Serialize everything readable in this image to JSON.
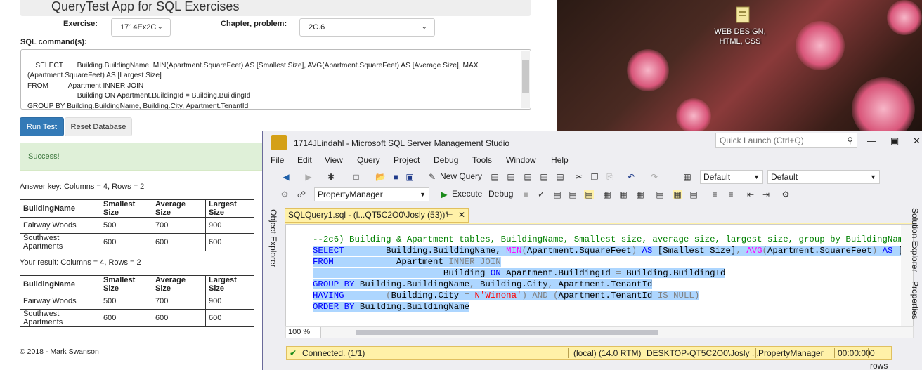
{
  "web": {
    "title": "QueryTest App for SQL Exercises",
    "exercise_label": "Exercise:",
    "exercise_value": "1714Ex2C",
    "chapter_label": "Chapter, problem:",
    "chapter_value": "2C.6",
    "sql_label": "SQL command(s):",
    "sql_text": "SELECT       Building.BuildingName, MIN(Apartment.SquareFeet) AS [Smallest Size], AVG(Apartment.SquareFeet) AS [Average Size], MAX\n(Apartment.SquareFeet) AS [Largest Size]\nFROM          Apartment INNER JOIN\n                         Building ON Apartment.BuildingId = Building.BuildingId\nGROUP BY Building.BuildingName, Building.City, Apartment.TenantId\nHAVING       (Building.City = N'Winona') AND (Apartment.TenantId IS NULL)",
    "run_button": "Run Test",
    "reset_button": "Reset Database",
    "alert": "Success!",
    "answer_key": "Answer key: Columns = 4, Rows = 2",
    "your_result": "Your result: Columns = 4, Rows = 2",
    "headers": [
      "BuildingName",
      "Smallest Size",
      "Average Size",
      "Largest Size"
    ],
    "answer_rows": [
      [
        "Fairway Woods",
        "500",
        "700",
        "900"
      ],
      [
        "Southwest Apartments",
        "600",
        "600",
        "600"
      ]
    ],
    "result_rows": [
      [
        "Fairway Woods",
        "500",
        "700",
        "900"
      ],
      [
        "Southwest Apartments",
        "600",
        "600",
        "600"
      ]
    ],
    "footer": "© 2018 - Mark Swanson"
  },
  "desktop": {
    "icon_label": "WEB DESIGN,\nHTML, CSS",
    "icon_name": "folder-icon"
  },
  "ssms": {
    "title": "1714JLindahl - Microsoft SQL Server Management Studio",
    "quick_launch": "Quick Launch (Ctrl+Q)",
    "menus": [
      "File",
      "Edit",
      "View",
      "Query",
      "Project",
      "Debug",
      "Tools",
      "Window",
      "Help"
    ],
    "new_query": "New Query",
    "config1": "Default",
    "config2": "Default",
    "database": "PropertyManager",
    "execute": "Execute",
    "debug": "Debug",
    "object_explorer": "Object Explorer",
    "tab_label": "SQLQuery1.sql - (l...QT5C2O0\\Josly (53))*",
    "solution_explorer": "Solution Explorer",
    "properties": "Properties",
    "zoom": "100 %",
    "status": {
      "connected": "Connected. (1/1)",
      "server": "(local) (14.0 RTM)",
      "user": "DESKTOP-QT5C2O0\\Josly ...",
      "db": "PropertyManager",
      "time": "00:00:00",
      "rows": "0 rows"
    }
  }
}
